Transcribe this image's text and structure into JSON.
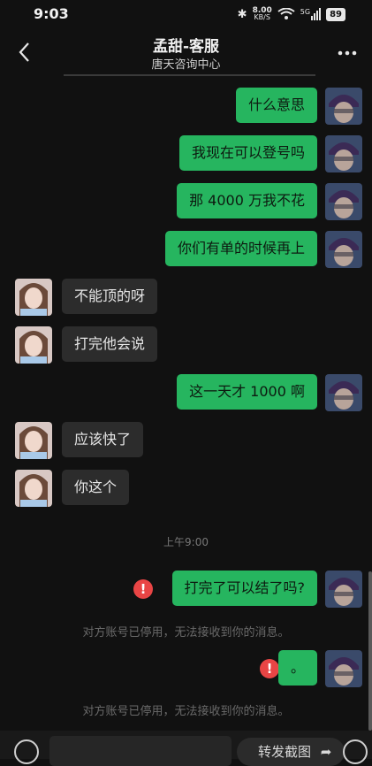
{
  "status_bar": {
    "time": "9:03",
    "net_speed": "8.00",
    "net_unit": "KB/S",
    "signal": "5G",
    "battery": "89"
  },
  "header": {
    "title": "孟甜-客服",
    "subtitle": "唐天咨询中心"
  },
  "messages": [
    {
      "side": "out",
      "text": "什么意思"
    },
    {
      "side": "out",
      "text": "我现在可以登号吗"
    },
    {
      "side": "out",
      "text": "那 4000 万我不花"
    },
    {
      "side": "out",
      "text": "你们有单的时候再上"
    },
    {
      "side": "in",
      "text": "不能顶的呀"
    },
    {
      "side": "in",
      "text": "打完他会说"
    },
    {
      "side": "out",
      "text": "这一天才 1000 啊"
    },
    {
      "side": "in",
      "text": "应该快了"
    },
    {
      "side": "in",
      "text": "你这个"
    },
    {
      "side": "out",
      "text": "打完了可以结了吗?",
      "failed": true
    },
    {
      "side": "out",
      "text": "。",
      "failed": true
    }
  ],
  "timestamp": "上午9:00",
  "failed_notice": "对方账号已停用，无法接收到你的消息。",
  "error_glyph": "!",
  "input_bar": {
    "forward_label": "转发截图"
  },
  "colors": {
    "outgoing": "#26b55f",
    "incoming": "#2c2c2c",
    "error": "#e94545",
    "background": "#111111"
  }
}
